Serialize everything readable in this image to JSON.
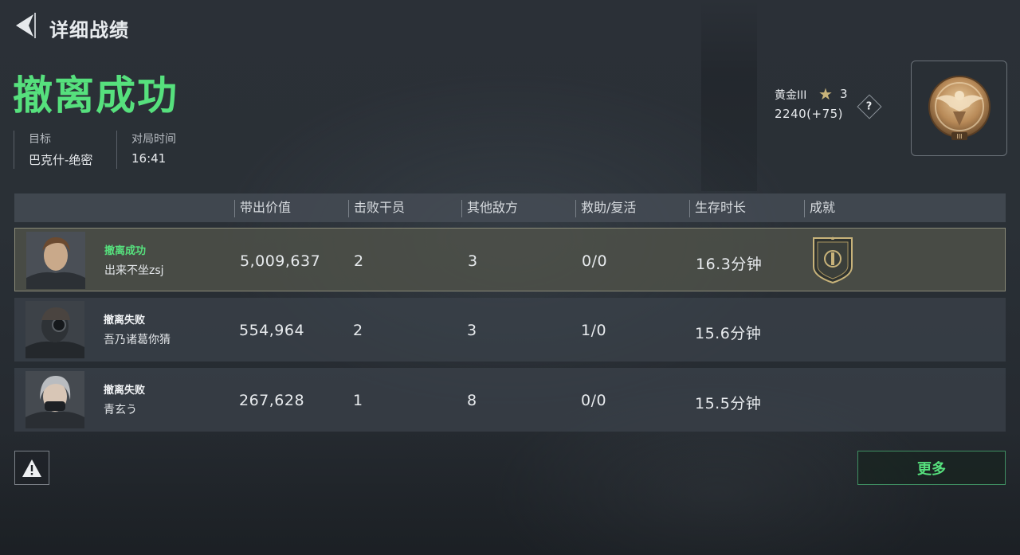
{
  "header": {
    "title": "详细战绩"
  },
  "result": {
    "status": "撤离成功"
  },
  "info": {
    "target_label": "目标",
    "target_value": "巴克什-绝密",
    "time_label": "对局时间",
    "time_value": "16:41"
  },
  "rank": {
    "name": "黄金III",
    "stars": "3",
    "points": "2240(+75)",
    "help": "?"
  },
  "table": {
    "columns": [
      "带出价值",
      "击败干员",
      "其他敌方",
      "救助/复活",
      "生存时长",
      "成就"
    ],
    "rows": [
      {
        "status": "撤离成功",
        "name": "出来不坐zsj",
        "value": "5,009,637",
        "kills": "2",
        "others": "3",
        "assist": "0/0",
        "survival": "16.3分钟",
        "achievement": true
      },
      {
        "status": "撤离失败",
        "name": "吾乃诸葛你猜",
        "value": "554,964",
        "kills": "2",
        "others": "3",
        "assist": "1/0",
        "survival": "15.6分钟",
        "achievement": false
      },
      {
        "status": "撤离失败",
        "name": "青玄う",
        "value": "267,628",
        "kills": "1",
        "others": "8",
        "assist": "0/0",
        "survival": "15.5分钟",
        "achievement": false
      }
    ]
  },
  "footer": {
    "more_label": "更多"
  },
  "colors": {
    "accent_green": "#56e07d",
    "gold": "#c8b37a"
  }
}
